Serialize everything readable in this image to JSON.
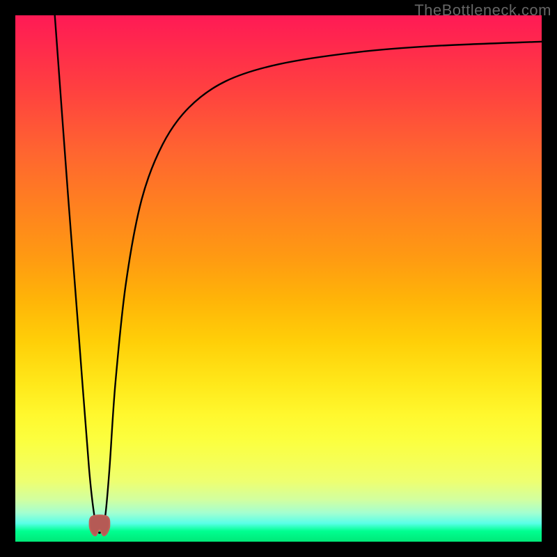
{
  "watermark": "TheBottleneck.com",
  "chart_data": {
    "type": "line",
    "title": "",
    "xlabel": "",
    "ylabel": "",
    "xlim": [
      0,
      100
    ],
    "ylim": [
      0,
      100
    ],
    "series": [
      {
        "name": "bottleneck-curve",
        "x": [
          7.5,
          10,
          12,
          14,
          15,
          15.7,
          16.3,
          17.1,
          17.9,
          19,
          21,
          24,
          28,
          33,
          40,
          50,
          65,
          80,
          100
        ],
        "y": [
          100,
          66,
          40,
          14,
          5,
          2,
          2,
          5,
          14,
          30,
          49,
          65,
          75.5,
          82.5,
          87.5,
          90.7,
          93,
          94.2,
          95
        ]
      },
      {
        "name": "marker-outline",
        "type": "blob",
        "cx": 16,
        "cy": 2.4,
        "points": [
          {
            "x": 14.6,
            "y": 4.8
          },
          {
            "x": 14.1,
            "y": 3.1
          },
          {
            "x": 14.6,
            "y": 1.6
          },
          {
            "x": 15.3,
            "y": 1.2
          },
          {
            "x": 16.0,
            "y": 2.3
          },
          {
            "x": 16.7,
            "y": 1.2
          },
          {
            "x": 17.4,
            "y": 1.6
          },
          {
            "x": 17.9,
            "y": 3.1
          },
          {
            "x": 17.4,
            "y": 4.8
          }
        ],
        "fill": "#b55a55",
        "stroke": "#c06158"
      }
    ]
  },
  "colors": {
    "gradient_top": "#ff1a55",
    "gradient_bottom": "#00e878",
    "curve_stroke": "#000000",
    "marker_fill": "#b55a55",
    "frame": "#000000"
  }
}
